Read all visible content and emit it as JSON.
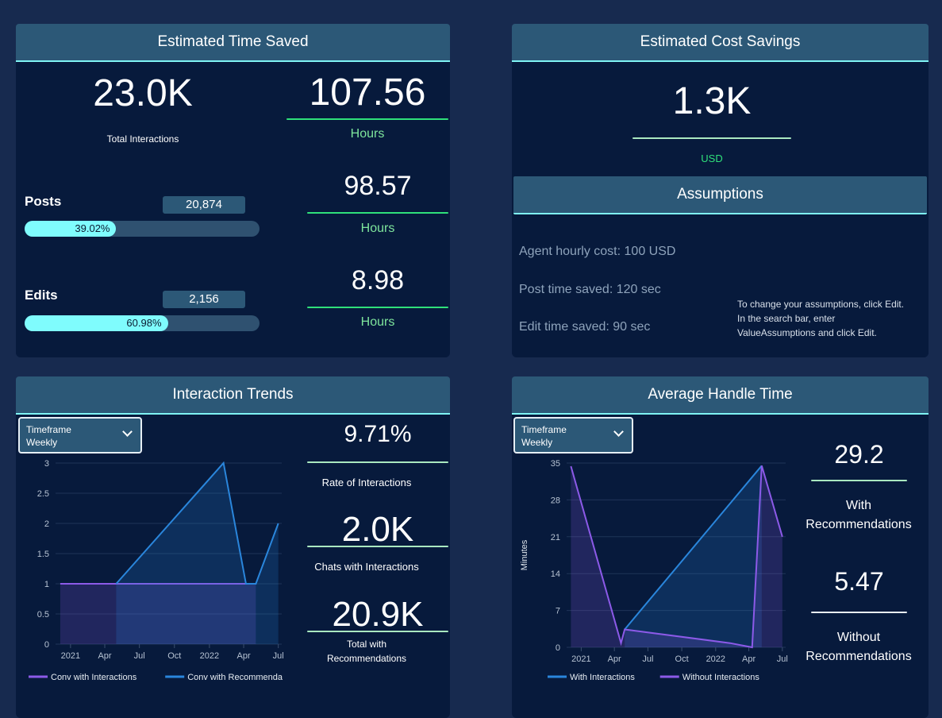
{
  "time_saved": {
    "title": "Estimated Time Saved",
    "total_value": "23.0K",
    "total_label": "Total Interactions",
    "total_hours": "107.56",
    "hours_label": "Hours",
    "posts": {
      "label": "Posts",
      "count": "20,874",
      "percent_text": "39.02%",
      "percent": 39.02,
      "hours": "98.57",
      "hours_label": "Hours"
    },
    "edits": {
      "label": "Edits",
      "count": "2,156",
      "percent_text": "60.98%",
      "percent": 60.98,
      "hours": "8.98",
      "hours_label": "Hours"
    }
  },
  "cost_savings": {
    "title": "Estimated Cost Savings",
    "value": "1.3K",
    "unit": "USD",
    "assumptions_title": "Assumptions",
    "assumptions": [
      "Agent hourly cost: 100 USD",
      "Post time saved: 120 sec",
      "Edit time saved: 90 sec"
    ],
    "note": [
      "To change your assumptions, click Edit.",
      "In the search bar, enter",
      "ValueAssumptions and click Edit."
    ]
  },
  "interaction_trends": {
    "title": "Interaction Trends",
    "dropdown": {
      "label": "Timeframe",
      "value": "Weekly"
    },
    "stats": [
      {
        "value": "9.71%",
        "label": "Rate of Interactions"
      },
      {
        "value": "2.0K",
        "label": "Chats with Interactions"
      },
      {
        "value": "20.9K",
        "label_lines": [
          "Total with",
          "Recommendations"
        ]
      }
    ]
  },
  "handle_time": {
    "title": "Average Handle Time",
    "dropdown": {
      "label": "Timeframe",
      "value": "Weekly"
    },
    "stats": [
      {
        "value": "29.2",
        "label_lines": [
          "With",
          "Recommendations"
        ]
      },
      {
        "value": "5.47",
        "label_lines": [
          "Without",
          "Recommendations"
        ]
      }
    ]
  },
  "colors": {
    "blue": "#2a86dc",
    "purple": "#8c5ae8",
    "accent": "#7ff4f4",
    "green": "#2fe07a"
  },
  "chart_data": [
    {
      "type": "area",
      "ylim": [
        0,
        3
      ],
      "yticks": [
        "0",
        "0.5",
        "1",
        "1.5",
        "2",
        "2.5",
        "3"
      ],
      "xticks": [
        [
          "2021-01-01",
          "2021"
        ],
        [
          "2021-04-01",
          "Apr"
        ],
        [
          "2021-07-01",
          "Jul"
        ],
        [
          "2021-10-01",
          "Oct"
        ],
        [
          "2022-01-01",
          "2022"
        ],
        [
          "2022-04-01",
          "Apr"
        ],
        [
          "2022-07-01",
          "Jul"
        ]
      ],
      "xlim": [
        "2020-12-01",
        "2022-07-10"
      ],
      "ylabel": "",
      "grid": true,
      "legend": "bottom",
      "series": [
        {
          "name": "Conv with Interactions",
          "color": "#8c5ae8",
          "points": [
            [
              "2020-12-05",
              1
            ],
            [
              "2022-05-03",
              1
            ]
          ]
        },
        {
          "name": "Conv with Recommenda",
          "color": "#2a86dc",
          "points": [
            [
              "2021-05-01",
              1
            ],
            [
              "2022-02-07",
              3
            ],
            [
              "2022-04-07",
              1
            ],
            [
              "2022-05-03",
              1
            ],
            [
              "2022-07-01",
              2
            ]
          ]
        }
      ]
    },
    {
      "type": "area",
      "ylim": [
        0,
        35
      ],
      "yticks": [
        "0",
        "7",
        "14",
        "21",
        "28",
        "35"
      ],
      "xticks": [
        [
          "2021-01-01",
          "2021"
        ],
        [
          "2021-04-01",
          "Apr"
        ],
        [
          "2021-07-01",
          "Jul"
        ],
        [
          "2021-10-01",
          "Oct"
        ],
        [
          "2022-01-01",
          "2022"
        ],
        [
          "2022-04-01",
          "Apr"
        ],
        [
          "2022-07-01",
          "Jul"
        ]
      ],
      "xlim": [
        "2020-12-01",
        "2022-07-10"
      ],
      "ylabel": "Minutes",
      "grid": true,
      "legend": "bottom",
      "series": [
        {
          "name": "With Interactions",
          "color": "#2a86dc",
          "points": [
            [
              "2021-04-29",
              3.4
            ],
            [
              "2022-05-06",
              34.5
            ]
          ]
        },
        {
          "name": "Without Interactions",
          "color": "#8c5ae8",
          "points": [
            [
              "2020-12-04",
              34.4
            ],
            [
              "2021-04-19",
              0.8
            ],
            [
              "2021-04-29",
              3.4
            ],
            [
              "2022-02-09",
              0.8
            ],
            [
              "2022-04-10",
              0
            ],
            [
              "2022-05-06",
              34.5
            ],
            [
              "2022-07-01",
              21
            ]
          ]
        }
      ]
    }
  ]
}
